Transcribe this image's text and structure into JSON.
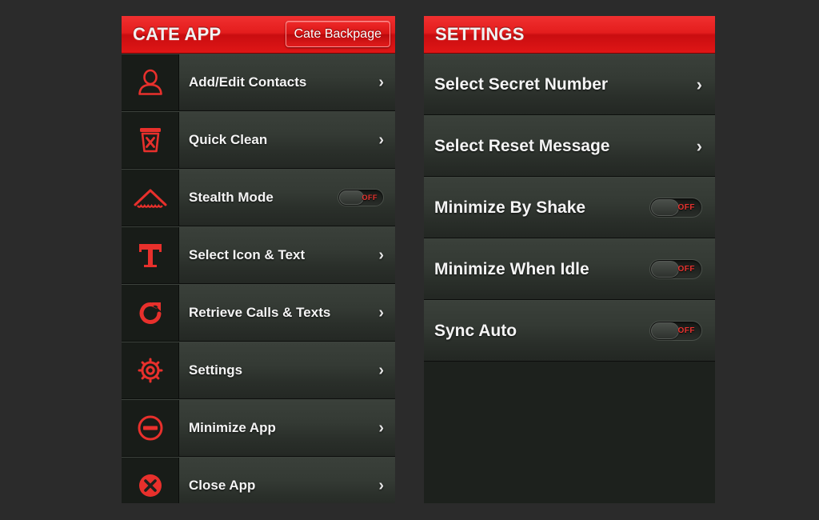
{
  "background_color": "#2b2b2b",
  "accent_color": "#e01616",
  "icon_color": "#e8302c",
  "left_panel": {
    "header": {
      "title": "CATE APP",
      "button_label": "Cate Backpage"
    },
    "items": [
      {
        "label": "Add/Edit Contacts",
        "icon": "person-icon",
        "control": "chevron"
      },
      {
        "label": "Quick Clean",
        "icon": "trash-x-icon",
        "control": "chevron"
      },
      {
        "label": "Stealth Mode",
        "icon": "stealth-wing-icon",
        "control": "toggle",
        "toggle_state": "OFF"
      },
      {
        "label": "Select Icon & Text",
        "icon": "text-t-icon",
        "control": "chevron"
      },
      {
        "label": "Retrieve Calls & Texts",
        "icon": "call-retrieve-icon",
        "control": "chevron"
      },
      {
        "label": "Settings",
        "icon": "gear-icon",
        "control": "chevron"
      },
      {
        "label": "Minimize App",
        "icon": "minus-circle-icon",
        "control": "chevron"
      },
      {
        "label": "Close App",
        "icon": "close-circle-icon",
        "control": "chevron"
      }
    ]
  },
  "right_panel": {
    "header": {
      "title": "SETTINGS"
    },
    "items": [
      {
        "label": "Select Secret Number",
        "control": "chevron"
      },
      {
        "label": "Select Reset Message",
        "control": "chevron"
      },
      {
        "label": "Minimize By Shake",
        "control": "toggle",
        "toggle_state": "OFF"
      },
      {
        "label": "Minimize When Idle",
        "control": "toggle",
        "toggle_state": "OFF"
      },
      {
        "label": "Sync Auto",
        "control": "toggle",
        "toggle_state": "OFF"
      }
    ],
    "chevron_glyph": "›"
  },
  "chevron_glyph": "›"
}
